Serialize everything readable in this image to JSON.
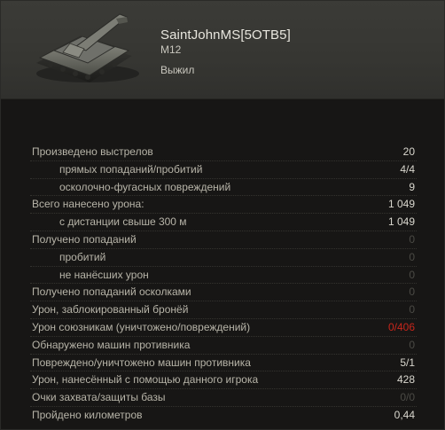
{
  "header": {
    "player_name": "SaintJohnMS[5OTB5]",
    "vehicle": "M12",
    "status": "Выжил",
    "tank_icon": "self-propelled-gun-icon"
  },
  "colors": {
    "normal_value": "#d9d7ce",
    "muted_value": "#4b4a45",
    "negative_value": "#c8261b",
    "label": "#b7b4a8"
  },
  "stats": [
    {
      "label": "Произведено выстрелов",
      "value": "20",
      "indent": false,
      "style": "normal"
    },
    {
      "label": "прямых попаданий/пробитий",
      "value": "4/4",
      "indent": true,
      "style": "normal"
    },
    {
      "label": "осколочно-фугасных повреждений",
      "value": "9",
      "indent": true,
      "style": "normal"
    },
    {
      "label": "Всего нанесено урона:",
      "value": "1 049",
      "indent": false,
      "style": "normal"
    },
    {
      "label": "с дистанции свыше 300 м",
      "value": "1 049",
      "indent": true,
      "style": "normal"
    },
    {
      "label": "Получено попаданий",
      "value": "0",
      "indent": false,
      "style": "muted"
    },
    {
      "label": "пробитий",
      "value": "0",
      "indent": true,
      "style": "muted"
    },
    {
      "label": "не нанёсших урон",
      "value": "0",
      "indent": true,
      "style": "muted"
    },
    {
      "label": "Получено попаданий осколками",
      "value": "0",
      "indent": false,
      "style": "muted"
    },
    {
      "label": "Урон, заблокированный бронёй",
      "value": "0",
      "indent": false,
      "style": "muted"
    },
    {
      "label": "Урон союзникам (уничтожено/повреждений)",
      "value": "0/406",
      "indent": false,
      "style": "red"
    },
    {
      "label": "Обнаружено машин противника",
      "value": "0",
      "indent": false,
      "style": "muted"
    },
    {
      "label": "Повреждено/уничтожено машин противника",
      "value": "5/1",
      "indent": false,
      "style": "normal"
    },
    {
      "label": "Урон, нанесённый с помощью данного игрока",
      "value": "428",
      "indent": false,
      "style": "normal"
    },
    {
      "label": "Очки захвата/защиты базы",
      "value": "0/0",
      "indent": false,
      "style": "muted"
    },
    {
      "label": "Пройдено километров",
      "value": "0,44",
      "indent": false,
      "style": "normal"
    }
  ]
}
